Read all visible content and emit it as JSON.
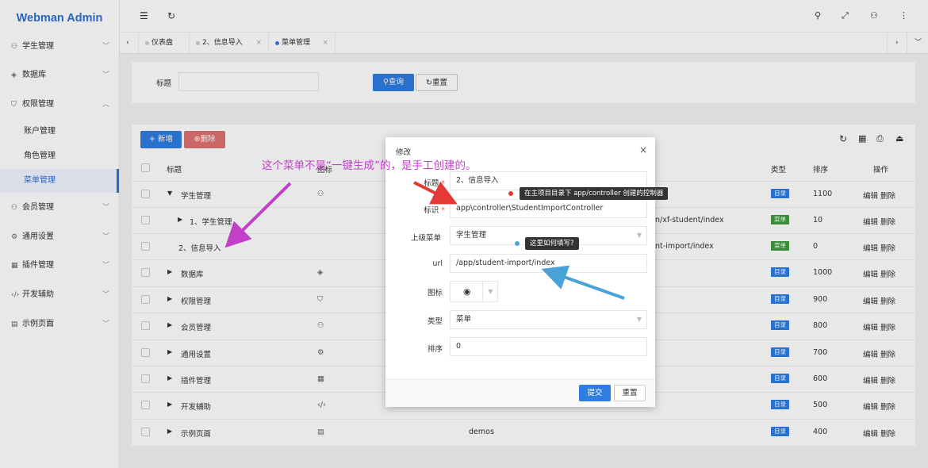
{
  "app": {
    "title": "Webman Admin"
  },
  "sidebar": {
    "items": [
      {
        "label": "学生管理",
        "icon": "user-icon"
      },
      {
        "label": "数据库",
        "icon": "layers-icon"
      },
      {
        "label": "权限管理",
        "icon": "shield-icon"
      },
      {
        "label": "会员管理",
        "icon": "person-icon"
      },
      {
        "label": "通用设置",
        "icon": "gear-icon"
      },
      {
        "label": "插件管理",
        "icon": "apps-icon"
      },
      {
        "label": "开发辅助",
        "icon": "code-icon"
      },
      {
        "label": "示例页面",
        "icon": "image-icon"
      }
    ],
    "sub": [
      {
        "label": "账户管理"
      },
      {
        "label": "角色管理"
      },
      {
        "label": "菜单管理"
      }
    ]
  },
  "tabs": [
    {
      "label": "仪表盘"
    },
    {
      "label": "2、信息导入"
    },
    {
      "label": "菜单管理"
    }
  ],
  "search": {
    "label": "标题",
    "query_btn": "查询",
    "reset_btn": "重置",
    "value": ""
  },
  "toolbar": {
    "add": "+ 新增",
    "delete": "删除"
  },
  "table": {
    "headers": [
      "标题",
      "图标",
      "类型",
      "排序",
      "操作"
    ],
    "rows": [
      {
        "title": "学生管理",
        "key": "",
        "type": "目录",
        "sort": "1100",
        "indent": 0,
        "arrow": "▼"
      },
      {
        "title": "1、学生管理",
        "key": "n/xf-student/index",
        "type": "菜单",
        "sort": "10",
        "indent": 1,
        "arrow": "▶"
      },
      {
        "title": "2、信息导入",
        "key": "nt-import/index",
        "type": "菜单",
        "sort": "0",
        "indent": 1,
        "arrow": ""
      },
      {
        "title": "数据库",
        "key": "",
        "type": "目录",
        "sort": "1000",
        "indent": 0,
        "arrow": "▶"
      },
      {
        "title": "权限管理",
        "key": "",
        "type": "目录",
        "sort": "900",
        "indent": 0,
        "arrow": "▶"
      },
      {
        "title": "会员管理",
        "key": "",
        "type": "目录",
        "sort": "800",
        "indent": 0,
        "arrow": "▶"
      },
      {
        "title": "通用设置",
        "key": "",
        "type": "目录",
        "sort": "700",
        "indent": 0,
        "arrow": "▶"
      },
      {
        "title": "插件管理",
        "key": "",
        "type": "目录",
        "sort": "600",
        "indent": 0,
        "arrow": "▶"
      },
      {
        "title": "开发辅助",
        "key": "dev",
        "type": "目录",
        "sort": "500",
        "indent": 0,
        "arrow": "▶"
      },
      {
        "title": "示例页面",
        "key": "demos",
        "type": "目录",
        "sort": "400",
        "indent": 0,
        "arrow": "▶"
      }
    ],
    "edit": "编辑",
    "del": "删除"
  },
  "modal": {
    "title": "修改",
    "fields": {
      "title_label": "标题",
      "title_value": "2、信息导入",
      "key_label": "标识",
      "key_value": "app\\controller\\StudentImportController",
      "parent_label": "上级菜单",
      "parent_value": "学生管理",
      "url_label": "url",
      "url_value": "/app/student-import/index",
      "icon_label": "图标",
      "type_label": "类型",
      "type_value": "菜单",
      "sort_label": "排序",
      "sort_value": "0"
    },
    "submit": "提交",
    "reset": "重置"
  },
  "annotations": {
    "note_main": "这个菜单不是“一键生成”的，是手工创建的。",
    "tip_key": "在主项目目录下 app/controller 创建的控制器",
    "tip_url": "这里如何填写?"
  },
  "colors": {
    "accent": "#2f7de1",
    "menu_badge": "#3f9a3f",
    "dir_badge": "#2f7de1",
    "annotation": "#c23fc8"
  }
}
